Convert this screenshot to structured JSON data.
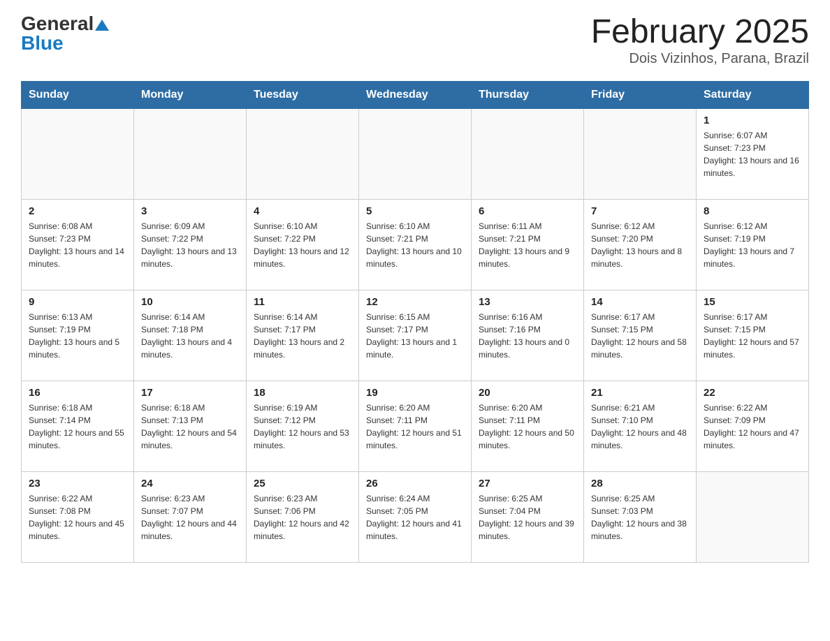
{
  "header": {
    "logo_general": "General",
    "logo_blue": "Blue",
    "title": "February 2025",
    "subtitle": "Dois Vizinhos, Parana, Brazil"
  },
  "days_of_week": [
    "Sunday",
    "Monday",
    "Tuesday",
    "Wednesday",
    "Thursday",
    "Friday",
    "Saturday"
  ],
  "weeks": [
    [
      {
        "day": "",
        "info": ""
      },
      {
        "day": "",
        "info": ""
      },
      {
        "day": "",
        "info": ""
      },
      {
        "day": "",
        "info": ""
      },
      {
        "day": "",
        "info": ""
      },
      {
        "day": "",
        "info": ""
      },
      {
        "day": "1",
        "info": "Sunrise: 6:07 AM\nSunset: 7:23 PM\nDaylight: 13 hours and 16 minutes."
      }
    ],
    [
      {
        "day": "2",
        "info": "Sunrise: 6:08 AM\nSunset: 7:23 PM\nDaylight: 13 hours and 14 minutes."
      },
      {
        "day": "3",
        "info": "Sunrise: 6:09 AM\nSunset: 7:22 PM\nDaylight: 13 hours and 13 minutes."
      },
      {
        "day": "4",
        "info": "Sunrise: 6:10 AM\nSunset: 7:22 PM\nDaylight: 13 hours and 12 minutes."
      },
      {
        "day": "5",
        "info": "Sunrise: 6:10 AM\nSunset: 7:21 PM\nDaylight: 13 hours and 10 minutes."
      },
      {
        "day": "6",
        "info": "Sunrise: 6:11 AM\nSunset: 7:21 PM\nDaylight: 13 hours and 9 minutes."
      },
      {
        "day": "7",
        "info": "Sunrise: 6:12 AM\nSunset: 7:20 PM\nDaylight: 13 hours and 8 minutes."
      },
      {
        "day": "8",
        "info": "Sunrise: 6:12 AM\nSunset: 7:19 PM\nDaylight: 13 hours and 7 minutes."
      }
    ],
    [
      {
        "day": "9",
        "info": "Sunrise: 6:13 AM\nSunset: 7:19 PM\nDaylight: 13 hours and 5 minutes."
      },
      {
        "day": "10",
        "info": "Sunrise: 6:14 AM\nSunset: 7:18 PM\nDaylight: 13 hours and 4 minutes."
      },
      {
        "day": "11",
        "info": "Sunrise: 6:14 AM\nSunset: 7:17 PM\nDaylight: 13 hours and 2 minutes."
      },
      {
        "day": "12",
        "info": "Sunrise: 6:15 AM\nSunset: 7:17 PM\nDaylight: 13 hours and 1 minute."
      },
      {
        "day": "13",
        "info": "Sunrise: 6:16 AM\nSunset: 7:16 PM\nDaylight: 13 hours and 0 minutes."
      },
      {
        "day": "14",
        "info": "Sunrise: 6:17 AM\nSunset: 7:15 PM\nDaylight: 12 hours and 58 minutes."
      },
      {
        "day": "15",
        "info": "Sunrise: 6:17 AM\nSunset: 7:15 PM\nDaylight: 12 hours and 57 minutes."
      }
    ],
    [
      {
        "day": "16",
        "info": "Sunrise: 6:18 AM\nSunset: 7:14 PM\nDaylight: 12 hours and 55 minutes."
      },
      {
        "day": "17",
        "info": "Sunrise: 6:18 AM\nSunset: 7:13 PM\nDaylight: 12 hours and 54 minutes."
      },
      {
        "day": "18",
        "info": "Sunrise: 6:19 AM\nSunset: 7:12 PM\nDaylight: 12 hours and 53 minutes."
      },
      {
        "day": "19",
        "info": "Sunrise: 6:20 AM\nSunset: 7:11 PM\nDaylight: 12 hours and 51 minutes."
      },
      {
        "day": "20",
        "info": "Sunrise: 6:20 AM\nSunset: 7:11 PM\nDaylight: 12 hours and 50 minutes."
      },
      {
        "day": "21",
        "info": "Sunrise: 6:21 AM\nSunset: 7:10 PM\nDaylight: 12 hours and 48 minutes."
      },
      {
        "day": "22",
        "info": "Sunrise: 6:22 AM\nSunset: 7:09 PM\nDaylight: 12 hours and 47 minutes."
      }
    ],
    [
      {
        "day": "23",
        "info": "Sunrise: 6:22 AM\nSunset: 7:08 PM\nDaylight: 12 hours and 45 minutes."
      },
      {
        "day": "24",
        "info": "Sunrise: 6:23 AM\nSunset: 7:07 PM\nDaylight: 12 hours and 44 minutes."
      },
      {
        "day": "25",
        "info": "Sunrise: 6:23 AM\nSunset: 7:06 PM\nDaylight: 12 hours and 42 minutes."
      },
      {
        "day": "26",
        "info": "Sunrise: 6:24 AM\nSunset: 7:05 PM\nDaylight: 12 hours and 41 minutes."
      },
      {
        "day": "27",
        "info": "Sunrise: 6:25 AM\nSunset: 7:04 PM\nDaylight: 12 hours and 39 minutes."
      },
      {
        "day": "28",
        "info": "Sunrise: 6:25 AM\nSunset: 7:03 PM\nDaylight: 12 hours and 38 minutes."
      },
      {
        "day": "",
        "info": ""
      }
    ]
  ]
}
